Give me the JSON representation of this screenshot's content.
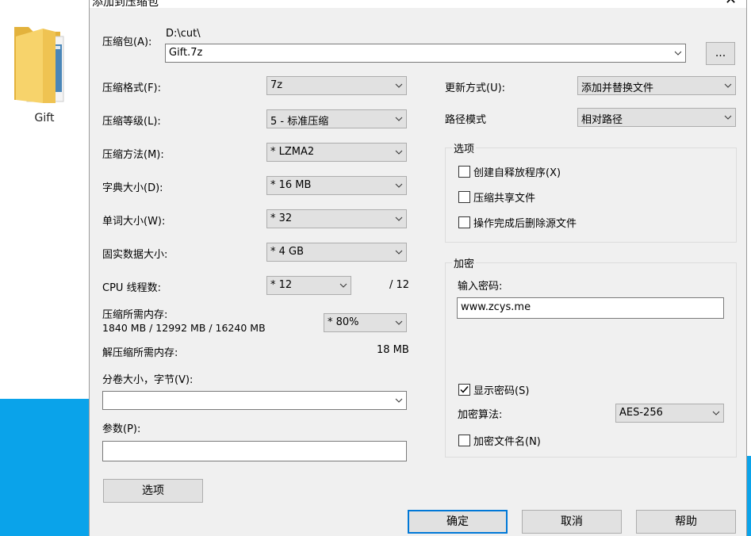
{
  "desktop": {
    "folder_label": "Gift"
  },
  "dialog": {
    "title": "添加到压缩包",
    "archive_label": "压缩包(A):",
    "archive_path": "D:\\cut\\",
    "archive_name": "Gift.7z",
    "browse_label": "...",
    "left": {
      "format_label": "压缩格式(F):",
      "format_value": "7z",
      "level_label": "压缩等级(L):",
      "level_value": "5 - 标准压缩",
      "method_label": "压缩方法(M):",
      "method_value": "* LZMA2",
      "dict_label": "字典大小(D):",
      "dict_value": "* 16 MB",
      "word_label": "单词大小(W):",
      "word_value": "* 32",
      "solid_label": "固实数据大小:",
      "solid_value": "* 4 GB",
      "cpu_label": "CPU 线程数:",
      "cpu_value": "* 12",
      "cpu_total": "/ 12",
      "mem_comp_label": "压缩所需内存:",
      "mem_comp_value": "1840 MB / 12992 MB / 16240 MB",
      "mem_percent": "* 80%",
      "mem_decomp_label": "解压缩所需内存:",
      "mem_decomp_value": "18 MB",
      "volume_label": "分卷大小，字节(V):",
      "volume_value": "",
      "params_label": "参数(P):",
      "params_value": "",
      "options_button": "选项"
    },
    "right": {
      "update_label": "更新方式(U):",
      "update_value": "添加并替换文件",
      "path_label": "路径模式",
      "path_value": "相对路径",
      "options_group": "选项",
      "opt_sfx": "创建自释放程序(X)",
      "opt_shared": "压缩共享文件",
      "opt_delete": "操作完成后删除源文件",
      "enc_group": "加密",
      "password_label": "输入密码:",
      "password_value": "www.zcys.me",
      "show_password": "显示密码(S)",
      "enc_method_label": "加密算法:",
      "enc_method_value": "AES-256",
      "enc_names": "加密文件名(N)"
    },
    "buttons": {
      "ok": "确定",
      "cancel": "取消",
      "help": "帮助"
    },
    "checks": {
      "sfx": false,
      "shared": false,
      "delete": false,
      "show_password": true,
      "enc_names": false
    }
  }
}
